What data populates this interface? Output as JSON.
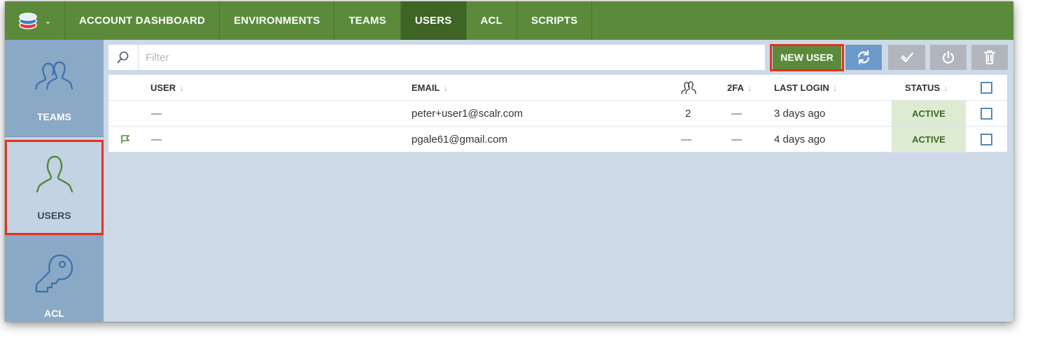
{
  "nav": {
    "logo_icon": "stack-layers-icon",
    "tabs": [
      {
        "label": "ACCOUNT DASHBOARD"
      },
      {
        "label": "ENVIRONMENTS"
      },
      {
        "label": "TEAMS"
      },
      {
        "label": "USERS",
        "active": true
      },
      {
        "label": "ACL"
      },
      {
        "label": "SCRIPTS"
      }
    ]
  },
  "sidebar": {
    "items": [
      {
        "label": "TEAMS",
        "icon": "teams-icon"
      },
      {
        "label": "USERS",
        "icon": "user-icon",
        "active": true
      },
      {
        "label": "ACL",
        "icon": "key-icon"
      }
    ]
  },
  "toolbar": {
    "filter_placeholder": "Filter",
    "new_user_label": "NEW USER",
    "buttons": [
      "refresh-icon",
      "activate-icon",
      "deactivate-icon",
      "delete-icon"
    ]
  },
  "table": {
    "columns": {
      "user": "USER",
      "email": "EMAIL",
      "teams_icon": "teams-icon",
      "twofa": "2FA",
      "last_login": "LAST LOGIN",
      "status": "STATUS"
    },
    "rows": [
      {
        "flag": false,
        "user": "—",
        "email": "peter+user1@scalr.com",
        "teams": "2",
        "twofa": "—",
        "last_login": "3 days ago",
        "status": "ACTIVE"
      },
      {
        "flag": true,
        "user": "—",
        "email": "pgale61@gmail.com",
        "teams": "—",
        "twofa": "—",
        "last_login": "4 days ago",
        "status": "ACTIVE"
      }
    ]
  },
  "colors": {
    "nav_green": "#5b8a3b",
    "nav_active": "#3e6426",
    "sidebar": "#8aa9c7",
    "highlight_red": "#e2321f",
    "status_bg": "#dcebd2"
  }
}
